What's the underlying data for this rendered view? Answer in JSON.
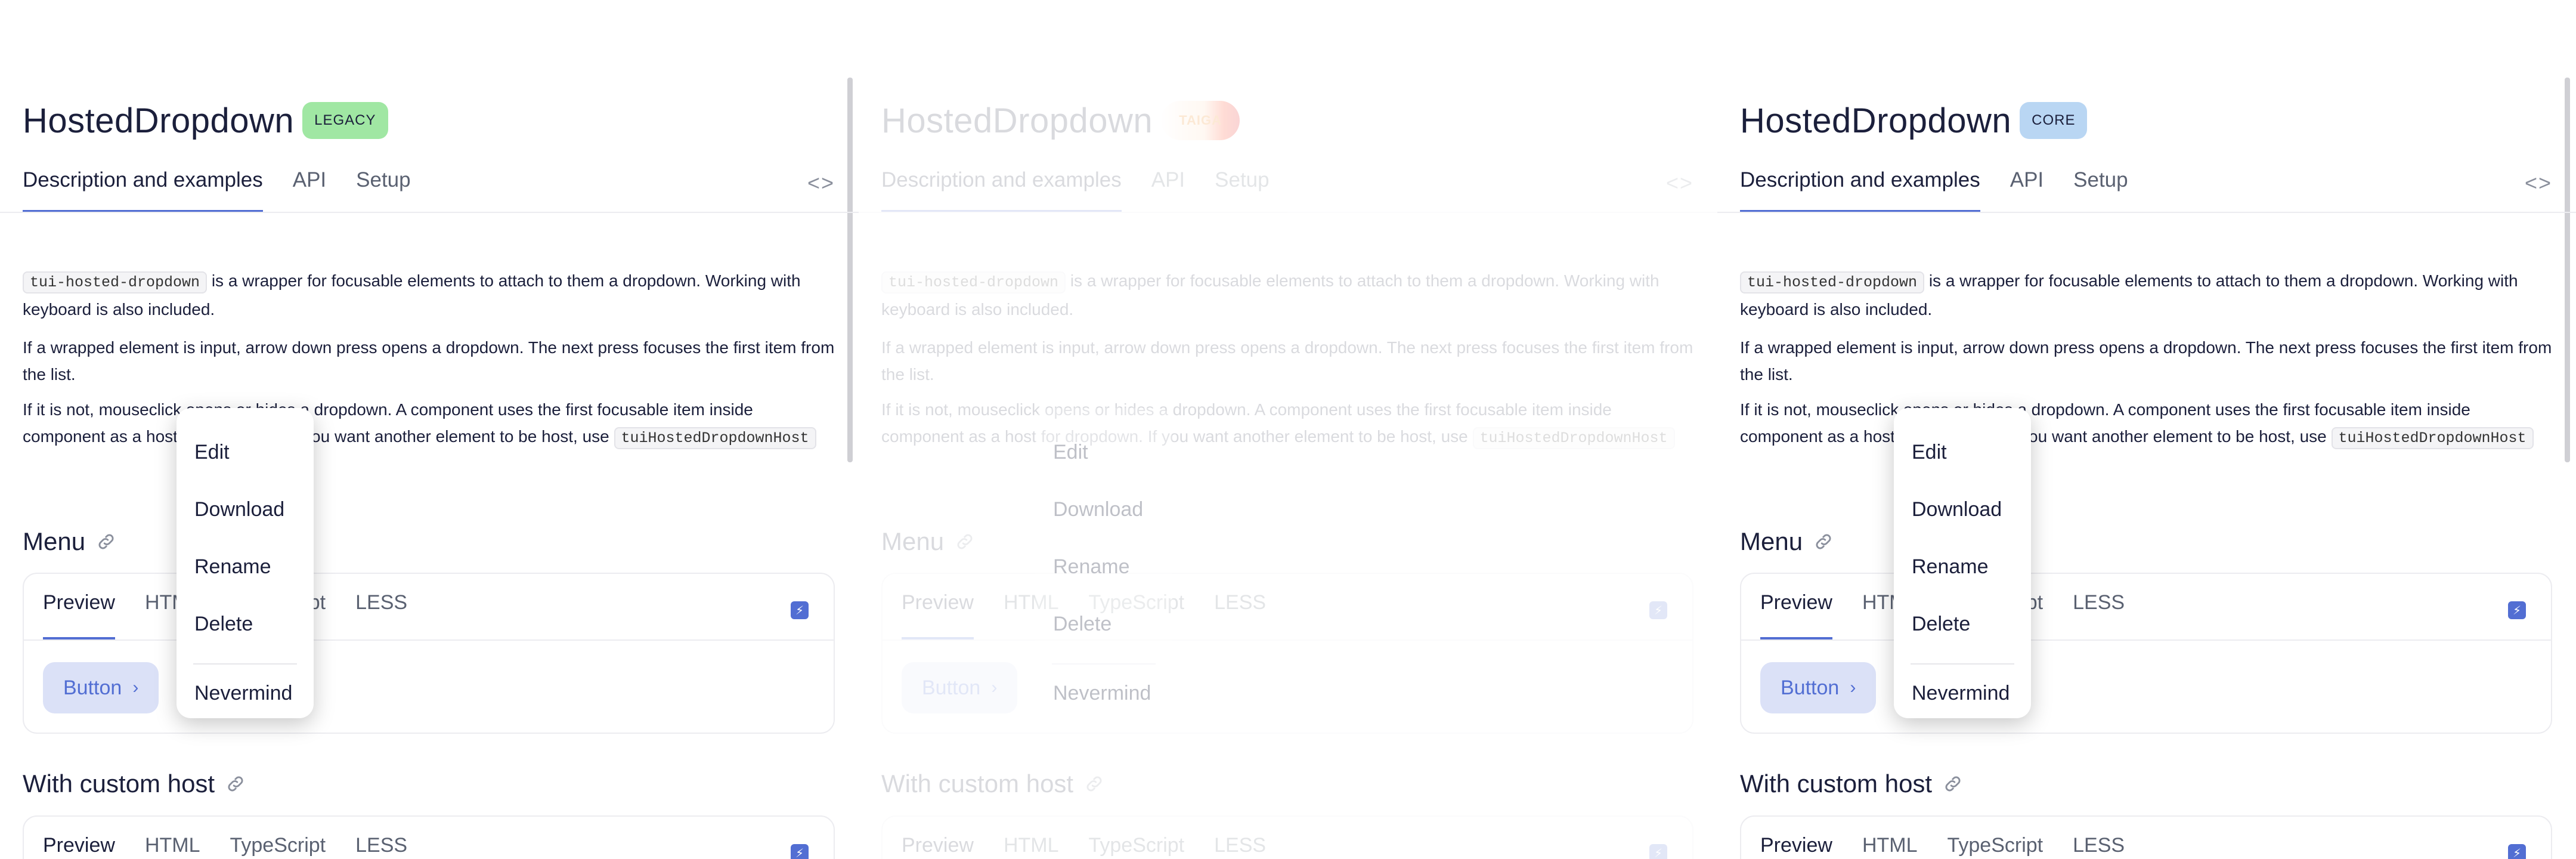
{
  "panels": [
    {
      "title": "HostedDropdown",
      "badge": "LEGACY",
      "tabs": [
        "Description and examples",
        "API",
        "Setup"
      ],
      "code_toggle": "<>",
      "para1_code": "tui-hosted-dropdown",
      "para1_text": " is a wrapper for focusable elements to attach to them a dropdown. Working with keyboard is also included.",
      "para2": "If a wrapped element is input, arrow down press opens a dropdown. The next press focuses the first item from the list.",
      "para3_text": "If it is not, mouseclick opens or hides a dropdown. A component uses the first focusable item inside component as a host for dropdown. If you want another element to be host, use ",
      "para3_code": "tuiHostedDropdownHost",
      "section_menu": "Menu",
      "section_custom": "With custom host",
      "demo_tabs": [
        "Preview",
        "HTML",
        "TypeScript",
        "LESS"
      ],
      "demo_button": "Button",
      "menu_items": [
        "Edit",
        "Download",
        "Rename",
        "Delete"
      ],
      "menu_last": "Nevermind"
    },
    {
      "title": "HostedDropdown",
      "badge": "TAIGA",
      "tabs": [
        "Description and examples",
        "API",
        "Setup"
      ],
      "code_toggle": "<>",
      "para1_code": "tui-hosted-dropdown",
      "para1_text": " is a wrapper for focusable elements to attach to them a dropdown. Working with keyboard is also included.",
      "para2": "If a wrapped element is input, arrow down press opens a dropdown. The next press focuses the first item from the list.",
      "para3_text": "If it is not, mouseclick opens or hides a dropdown. A component uses the first focusable item inside component as a host for dropdown. If you want another element to be host, use ",
      "para3_code": "tuiHostedDropdownHost",
      "section_menu": "Menu",
      "section_custom": "With custom host",
      "demo_tabs": [
        "Preview",
        "HTML",
        "TypeScript",
        "LESS"
      ],
      "demo_button": "Button",
      "menu_items": [
        "Edit",
        "Download",
        "Rename",
        "Delete"
      ],
      "menu_last": "Nevermind"
    },
    {
      "title": "HostedDropdown",
      "badge": "CORE",
      "tabs": [
        "Description and examples",
        "API",
        "Setup"
      ],
      "code_toggle": "<>",
      "para1_code": "tui-hosted-dropdown",
      "para1_text": " is a wrapper for focusable elements to attach to them a dropdown. Working with keyboard is also included.",
      "para2": "If a wrapped element is input, arrow down press opens a dropdown. The next press focuses the first item from the list.",
      "para3_text": "If it is not, mouseclick opens or hides a dropdown. A component uses the first focusable item inside component as a host for dropdown. If you want another element to be host, use ",
      "para3_code": "tuiHostedDropdownHost",
      "section_menu": "Menu",
      "section_custom": "With custom host",
      "demo_tabs": [
        "Preview",
        "HTML",
        "TypeScript",
        "LESS"
      ],
      "demo_button": "Button",
      "menu_items": [
        "Edit",
        "Download",
        "Rename",
        "Delete"
      ],
      "menu_last": "Nevermind"
    }
  ],
  "colors": {
    "accent": "#526ed3",
    "legacy_badge": "#a0e7a3",
    "core_badge": "#b9d6f3",
    "button_bg": "#dbe1f7",
    "text": "#1b1f3b"
  },
  "icons": {
    "link": "link-icon",
    "code": "code-toggle-icon",
    "stackblitz": "stackblitz-icon",
    "chevron": "chevron-right-icon"
  }
}
